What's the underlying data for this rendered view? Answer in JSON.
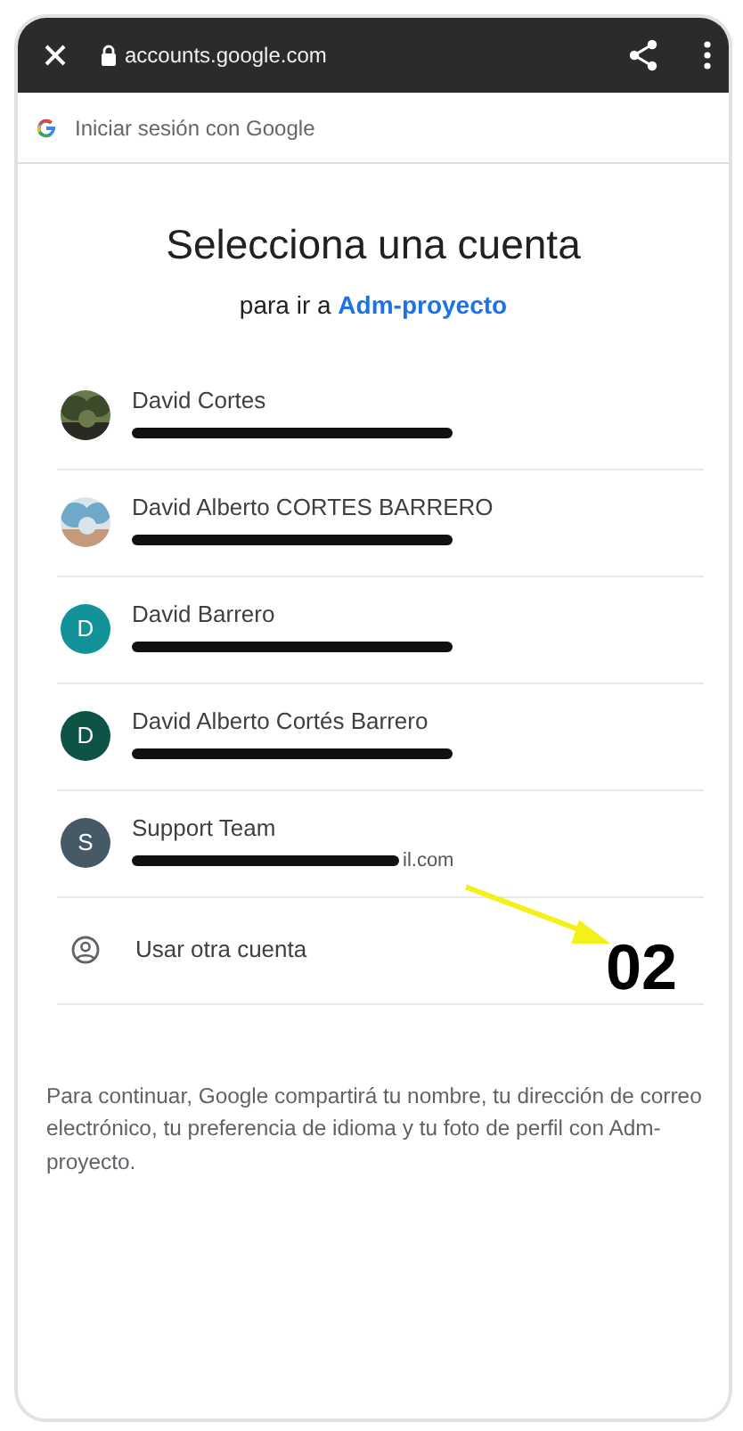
{
  "browser_bar": {
    "url": "accounts.google.com"
  },
  "header": {
    "title": "Iniciar sesión con Google"
  },
  "title": "Selecciona una cuenta",
  "subtitle": {
    "prefix": "para ir a",
    "app": "Adm-proyecto"
  },
  "accounts": [
    {
      "name": "David Cortes",
      "redacted": true
    },
    {
      "name": "David Alberto CORTES BARRERO",
      "redacted": true
    },
    {
      "name": "David Barrero",
      "kind": "letter",
      "letter": "D",
      "color": "#12939a",
      "redacted": true
    },
    {
      "name": "David Alberto Cortés Barrero",
      "kind": "letter",
      "letter": "D",
      "color": "#0d5446",
      "redacted": true
    },
    {
      "name": "Support Team",
      "kind": "letter",
      "letter": "S",
      "color": "#455a64",
      "redacted": true,
      "email_tail": "il.com"
    }
  ],
  "other_account": "Usar otra cuenta",
  "disclaimer": "Para continuar, Google compartirá tu nombre, tu dirección de correo electrónico, tu preferencia de idioma y tu foto de perfil con Adm-proyecto.",
  "annotation": {
    "label": "02"
  }
}
